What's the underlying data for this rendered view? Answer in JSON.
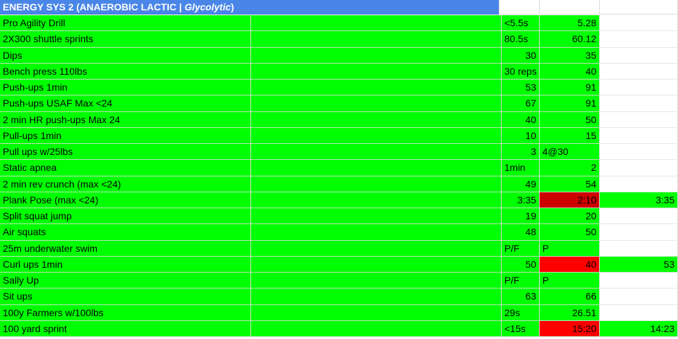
{
  "sheet": {
    "title_main": "ENERGY SYS 2 (ANAEROBIC LACTIC | ",
    "title_italic": "Glycolytic",
    "title_end": ")",
    "colors": {
      "green": "#00ff00",
      "red": "#ff0000",
      "dark_red": "#cc0000",
      "header_blue": "#4a86e8"
    },
    "rows": [
      {
        "name": "Pro Agility Drill",
        "target": "<5.5s",
        "target_align": "left",
        "result": "5.28",
        "result_align": "right",
        "result_fill": "green",
        "extra": "",
        "extra_fill": "white"
      },
      {
        "name": "2X300 shuttle sprints",
        "target": "80.5s",
        "target_align": "left",
        "result": "60.12",
        "result_align": "right",
        "result_fill": "green",
        "extra": "",
        "extra_fill": "white"
      },
      {
        "name": "Dips",
        "target": "30",
        "target_align": "right",
        "result": "35",
        "result_align": "right",
        "result_fill": "green",
        "extra": "",
        "extra_fill": "white"
      },
      {
        "name": "Bench press 110lbs",
        "target": "30 reps",
        "target_align": "left",
        "result": "40",
        "result_align": "right",
        "result_fill": "green",
        "extra": "",
        "extra_fill": "white"
      },
      {
        "name": "Push-ups 1min",
        "target": "53",
        "target_align": "right",
        "result": "91",
        "result_align": "right",
        "result_fill": "green",
        "extra": "",
        "extra_fill": "white"
      },
      {
        "name": "Push-ups USAF Max <24",
        "target": "67",
        "target_align": "right",
        "result": "91",
        "result_align": "right",
        "result_fill": "green",
        "extra": "",
        "extra_fill": "white"
      },
      {
        "name": "2 min HR push-ups Max 24",
        "target": "40",
        "target_align": "right",
        "result": "50",
        "result_align": "right",
        "result_fill": "green",
        "extra": "",
        "extra_fill": "white"
      },
      {
        "name": "Pull-ups 1min",
        "target": "10",
        "target_align": "right",
        "result": "15",
        "result_align": "right",
        "result_fill": "green",
        "extra": "",
        "extra_fill": "white"
      },
      {
        "name": "Pull ups w/25lbs",
        "target": "3",
        "target_align": "right",
        "result": "4@30",
        "result_align": "left",
        "result_fill": "green",
        "extra": "",
        "extra_fill": "white"
      },
      {
        "name": "Static apnea",
        "target": "1min",
        "target_align": "left",
        "result": "2",
        "result_align": "right",
        "result_fill": "green",
        "extra": "",
        "extra_fill": "white"
      },
      {
        "name": "2 min rev crunch (max <24)",
        "target": "49",
        "target_align": "right",
        "result": "54",
        "result_align": "right",
        "result_fill": "green",
        "extra": "",
        "extra_fill": "white"
      },
      {
        "name": "Plank Pose (max <24)",
        "target": "3:35",
        "target_align": "right",
        "result": "2:10",
        "result_align": "right",
        "result_fill": "dark_red",
        "extra": "3:35",
        "extra_fill": "green"
      },
      {
        "name": "Split squat jump",
        "target": "19",
        "target_align": "right",
        "result": "20",
        "result_align": "right",
        "result_fill": "green",
        "extra": "",
        "extra_fill": "white"
      },
      {
        "name": "Air squats",
        "target": "48",
        "target_align": "right",
        "result": "50",
        "result_align": "right",
        "result_fill": "green",
        "extra": "",
        "extra_fill": "white"
      },
      {
        "name": "25m underwater swim",
        "target": "P/F",
        "target_align": "left",
        "result": "P",
        "result_align": "left",
        "result_fill": "green",
        "extra": "",
        "extra_fill": "white"
      },
      {
        "name": "Curl ups 1min",
        "target": "50",
        "target_align": "right",
        "result": "40",
        "result_align": "right",
        "result_fill": "red",
        "extra": "53",
        "extra_fill": "green"
      },
      {
        "name": "Sally Up",
        "target": "P/F",
        "target_align": "left",
        "result": "P",
        "result_align": "left",
        "result_fill": "green",
        "extra": "",
        "extra_fill": "white"
      },
      {
        "name": "Sit ups",
        "target": "63",
        "target_align": "right",
        "result": "66",
        "result_align": "right",
        "result_fill": "green",
        "extra": "",
        "extra_fill": "white"
      },
      {
        "name": "100y Farmers w/100lbs",
        "target": "29s",
        "target_align": "left",
        "result": "26.51",
        "result_align": "right",
        "result_fill": "green",
        "extra": "",
        "extra_fill": "white"
      },
      {
        "name": "100 yard sprint",
        "target": "<15s",
        "target_align": "left",
        "result": "15:20",
        "result_align": "right",
        "result_fill": "red",
        "extra": "14:23",
        "extra_fill": "green"
      }
    ]
  }
}
